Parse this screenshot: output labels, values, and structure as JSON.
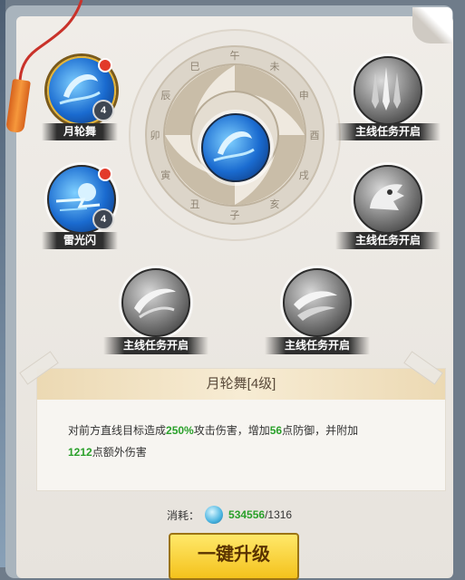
{
  "wheel": {
    "glyphs": [
      "午",
      "未",
      "申",
      "酉",
      "戌",
      "亥",
      "子",
      "丑",
      "寅",
      "卯",
      "辰",
      "巳"
    ]
  },
  "skills": [
    {
      "name": "月轮舞",
      "level": "4",
      "icon": "crescent-moon-skill-icon",
      "active": true,
      "selected": true
    },
    {
      "name": "雷光闪",
      "level": "4",
      "icon": "lightning-dash-skill-icon",
      "active": true,
      "selected": false
    },
    {
      "name": "主线任务开启",
      "icon": "triple-sword-skill-icon",
      "active": false
    },
    {
      "name": "主线任务开启",
      "icon": "dragon-head-skill-icon",
      "active": false
    },
    {
      "name": "主线任务开启",
      "icon": "crescent-slash-skill-icon",
      "active": false
    },
    {
      "name": "主线任务开启",
      "icon": "double-slash-skill-icon",
      "active": false
    }
  ],
  "center_icon": "crescent-moon-skill-icon",
  "detail": {
    "title": "月轮舞[4级]",
    "desc_part1": "对前方直线目标造成",
    "value1": "250%",
    "desc_part2": "攻击伤害，增加",
    "value2": "56",
    "desc_part3": "点防御，并附加",
    "value3": "1212",
    "desc_part4": "点额外伤害"
  },
  "cost": {
    "label": "消耗：",
    "have": "534556",
    "need": "/1316"
  },
  "upgrade_button": "一键升级",
  "colors": {
    "highlight_green": "#2aa02a",
    "button_yellow": "#f4c21c",
    "level_badge": "#3e4652",
    "red_dot": "#e23a2a"
  }
}
